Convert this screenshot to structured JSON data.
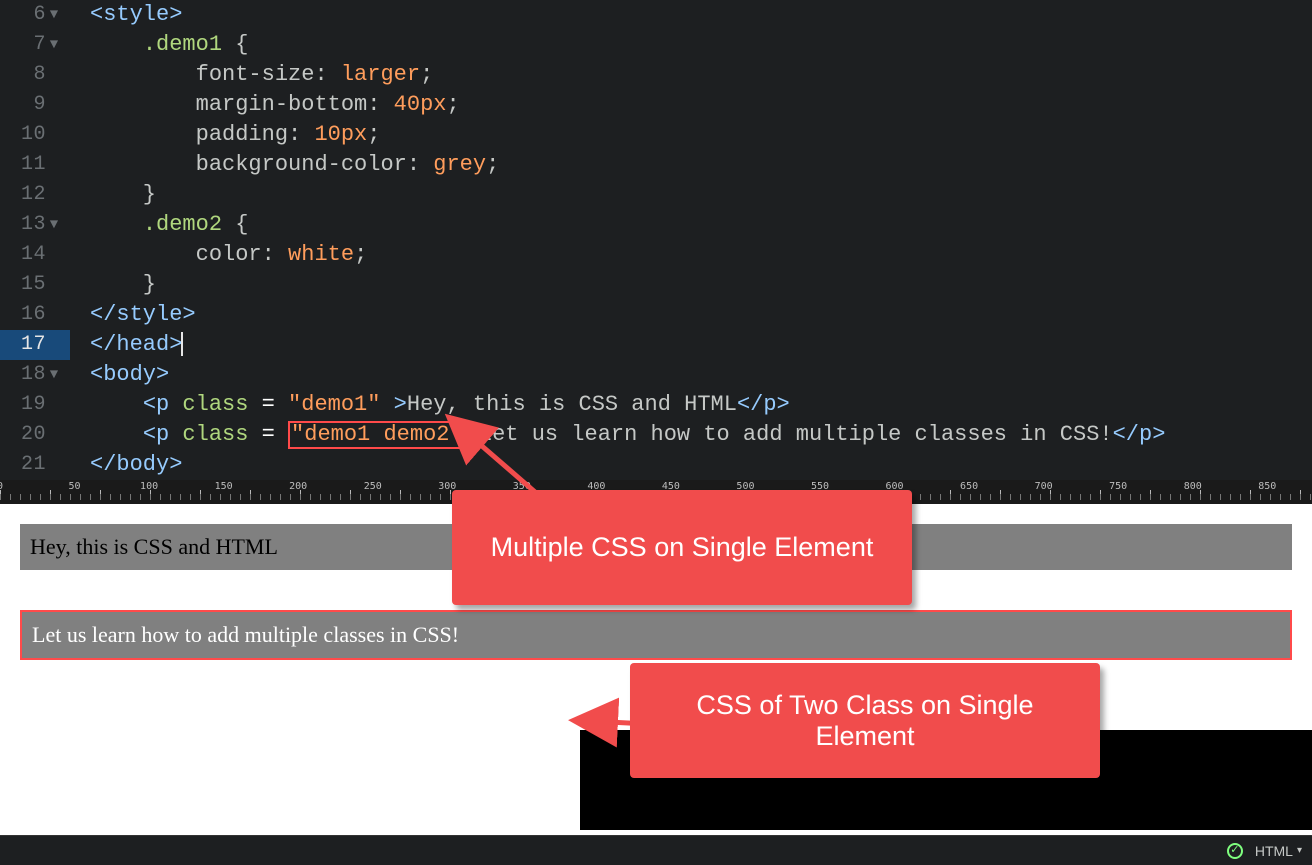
{
  "editor": {
    "startLine": 6,
    "activeLine": 17,
    "foldable": [
      6,
      7,
      13,
      18
    ],
    "lines": [
      [
        {
          "t": "tag",
          "v": "<style>"
        }
      ],
      [
        {
          "t": "punct",
          "v": "    "
        },
        {
          "t": "sel",
          "v": ".demo1"
        },
        {
          "t": "punct",
          "v": " {"
        }
      ],
      [
        {
          "t": "punct",
          "v": "        "
        },
        {
          "t": "prop",
          "v": "font-size"
        },
        {
          "t": "punct",
          "v": ": "
        },
        {
          "t": "val",
          "v": "larger"
        },
        {
          "t": "punct",
          "v": ";"
        }
      ],
      [
        {
          "t": "punct",
          "v": "        "
        },
        {
          "t": "prop",
          "v": "margin-bottom"
        },
        {
          "t": "punct",
          "v": ": "
        },
        {
          "t": "val",
          "v": "40px"
        },
        {
          "t": "punct",
          "v": ";"
        }
      ],
      [
        {
          "t": "punct",
          "v": "        "
        },
        {
          "t": "prop",
          "v": "padding"
        },
        {
          "t": "punct",
          "v": ": "
        },
        {
          "t": "val",
          "v": "10px"
        },
        {
          "t": "punct",
          "v": ";"
        }
      ],
      [
        {
          "t": "punct",
          "v": "        "
        },
        {
          "t": "prop",
          "v": "background-color"
        },
        {
          "t": "punct",
          "v": ": "
        },
        {
          "t": "val",
          "v": "grey"
        },
        {
          "t": "punct",
          "v": ";"
        }
      ],
      [
        {
          "t": "punct",
          "v": "    }"
        }
      ],
      [
        {
          "t": "punct",
          "v": "    "
        },
        {
          "t": "sel",
          "v": ".demo2"
        },
        {
          "t": "punct",
          "v": " {"
        }
      ],
      [
        {
          "t": "punct",
          "v": "        "
        },
        {
          "t": "prop",
          "v": "color"
        },
        {
          "t": "punct",
          "v": ": "
        },
        {
          "t": "val",
          "v": "white"
        },
        {
          "t": "punct",
          "v": ";"
        }
      ],
      [
        {
          "t": "punct",
          "v": "    }"
        }
      ],
      [
        {
          "t": "tag",
          "v": "</style>"
        }
      ],
      [
        {
          "t": "tag",
          "v": "</head>"
        },
        {
          "t": "cursor",
          "v": ""
        }
      ],
      [
        {
          "t": "tag",
          "v": "<body>"
        }
      ],
      [
        {
          "t": "punct",
          "v": "    "
        },
        {
          "t": "tag",
          "v": "<p"
        },
        {
          "t": "punct",
          "v": " "
        },
        {
          "t": "attr",
          "v": "class"
        },
        {
          "t": "punct",
          "v": " "
        },
        {
          "t": "white",
          "v": "="
        },
        {
          "t": "punct",
          "v": " "
        },
        {
          "t": "str",
          "v": "\"demo1\""
        },
        {
          "t": "punct",
          "v": " "
        },
        {
          "t": "tag",
          "v": ">"
        },
        {
          "t": "text",
          "v": "Hey, this is CSS and HTML"
        },
        {
          "t": "tag",
          "v": "</p>"
        }
      ],
      [
        {
          "t": "punct",
          "v": "    "
        },
        {
          "t": "tag",
          "v": "<p"
        },
        {
          "t": "punct",
          "v": " "
        },
        {
          "t": "attr",
          "v": "class"
        },
        {
          "t": "punct",
          "v": " "
        },
        {
          "t": "white",
          "v": "="
        },
        {
          "t": "punct",
          "v": " "
        },
        {
          "t": "strhl",
          "v": "\"demo1 demo2\""
        },
        {
          "t": "tag",
          "v": ">"
        },
        {
          "t": "text",
          "v": "Let us learn how to add multiple classes in CSS!"
        },
        {
          "t": "tag",
          "v": "</p>"
        }
      ],
      [
        {
          "t": "tag",
          "v": "</body>"
        }
      ]
    ]
  },
  "ruler": {
    "start": 0,
    "end": 850,
    "step": 50
  },
  "preview": {
    "p1": "Hey, this is CSS and HTML",
    "p2": "Let us learn how to add multiple classes in CSS!"
  },
  "callouts": {
    "c1": "Multiple CSS on Single Element",
    "c2": "CSS of Two Class on Single Element"
  },
  "statusbar": {
    "lang": "HTML"
  }
}
